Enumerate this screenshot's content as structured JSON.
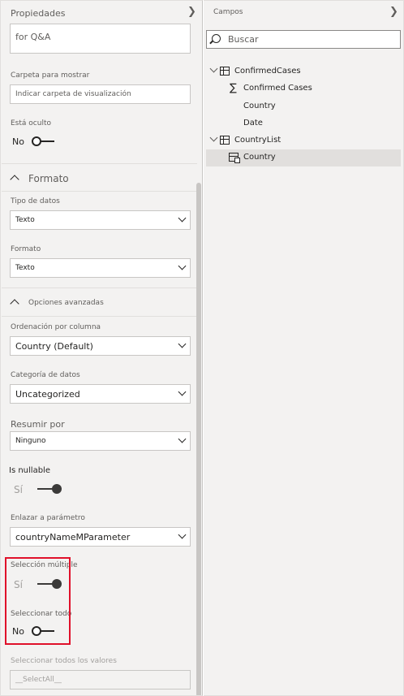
{
  "properties": {
    "title": "Propiedades",
    "qa_text": "for Q&A",
    "display_folder": {
      "label": "Carpeta para mostrar",
      "placeholder": "Indicar carpeta de visualización"
    },
    "hidden": {
      "label": "Está oculto",
      "state": "No"
    },
    "format_section": {
      "title": "Formato"
    },
    "data_type": {
      "label": "Tipo de datos",
      "value": "Texto"
    },
    "format": {
      "label": "Formato",
      "value": "Texto"
    },
    "advanced_section": {
      "title": "Opciones avanzadas"
    },
    "sort_by_column": {
      "label": "Ordenación por columna",
      "value": "Country (Default)"
    },
    "data_category": {
      "label": "Categoría de datos",
      "value": "Uncategorized"
    },
    "summarize_by": {
      "label": "Resumir por",
      "value": "Ninguno"
    },
    "nullable": {
      "label": "Is nullable",
      "state": "Sí"
    },
    "bind_to_parameter": {
      "label": "Enlazar a parámetro",
      "value": "countryNameMParameter"
    },
    "multi_select": {
      "label": "Selección múltiple",
      "state": "Sí"
    },
    "select_all": {
      "label": "Seleccionar todo",
      "state": "No"
    },
    "select_all_values": {
      "label": "Seleccionar todos los valores",
      "value": "__SelectAll__"
    }
  },
  "fields": {
    "title": "Campos",
    "search_placeholder": "Buscar",
    "tables": [
      {
        "name": "ConfirmedCases",
        "items": [
          "Confirmed Cases",
          "Country",
          "Date"
        ]
      },
      {
        "name": "CountryList",
        "items": [
          "Country"
        ]
      }
    ]
  },
  "colors": {
    "highlight": "#e0102a",
    "pane_bg": "#f3f2f1",
    "selected_row": "#e1dfdd"
  }
}
